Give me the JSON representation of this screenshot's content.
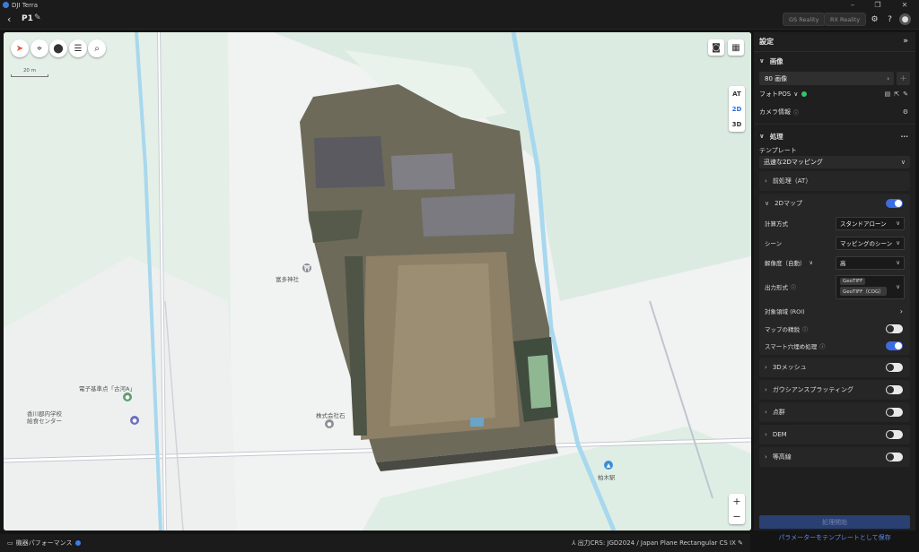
{
  "app": {
    "title": "DJI Terra"
  },
  "header": {
    "project_name": "P1",
    "buttons": [
      "GS Reality",
      "RX Reality"
    ]
  },
  "map": {
    "scale_label": "20 m",
    "view_modes": [
      "AT",
      "2D",
      "3D"
    ],
    "active_view": "2D",
    "zoom_in": "+",
    "zoom_out": "−",
    "pois": {
      "shrine": "富多神社",
      "marker": "電子基準点「古河A」",
      "center_line1": "香川郡内学校",
      "center_line2": "給食センター",
      "company": "株式会社石",
      "station": "柏木駅"
    }
  },
  "panel": {
    "title": "設定",
    "images": {
      "section": "画像",
      "count_label": "80 画像",
      "photo_pos": "フォトPOS",
      "camera_info": "カメラ情報"
    },
    "processing": {
      "section": "処理",
      "template_label": "テンプレート",
      "template_value": "迅速な2Dマッピング",
      "preprocess": "前処理（AT）",
      "map2d": {
        "label": "2Dマップ",
        "enabled": true,
        "calc_method_label": "計算方式",
        "calc_method_value": "スタンドアローン",
        "scene_label": "シーン",
        "scene_value": "マッピングのシーン",
        "resolution_label": "解像度（自動）",
        "resolution_value": "高",
        "output_label": "出力形式",
        "output_formats": [
          "GeoTIFF",
          "GeoTIFF（COG）"
        ],
        "roi_label": "対象領域 (ROI)",
        "map_merge_label": "マップの精鋭",
        "map_merge_enabled": false,
        "smart_fill_label": "スマート穴埋め処理",
        "smart_fill_enabled": true
      },
      "mesh3d": {
        "label": "3Dメッシュ",
        "enabled": false
      },
      "gaussian": {
        "label": "ガウシアンスプラッティング",
        "enabled": false
      },
      "pointcloud": {
        "label": "点群",
        "enabled": false
      },
      "dem": {
        "label": "DEM",
        "enabled": false
      },
      "contour": {
        "label": "等高線",
        "enabled": false
      }
    },
    "run_button": "処理開始",
    "save_template": "パラメーターをテンプレートとして保存"
  },
  "status": {
    "perf": "機器パフォーマンス",
    "crs": "出力CRS: JGD2024 / Japan Plane Rectangular CS IX"
  }
}
